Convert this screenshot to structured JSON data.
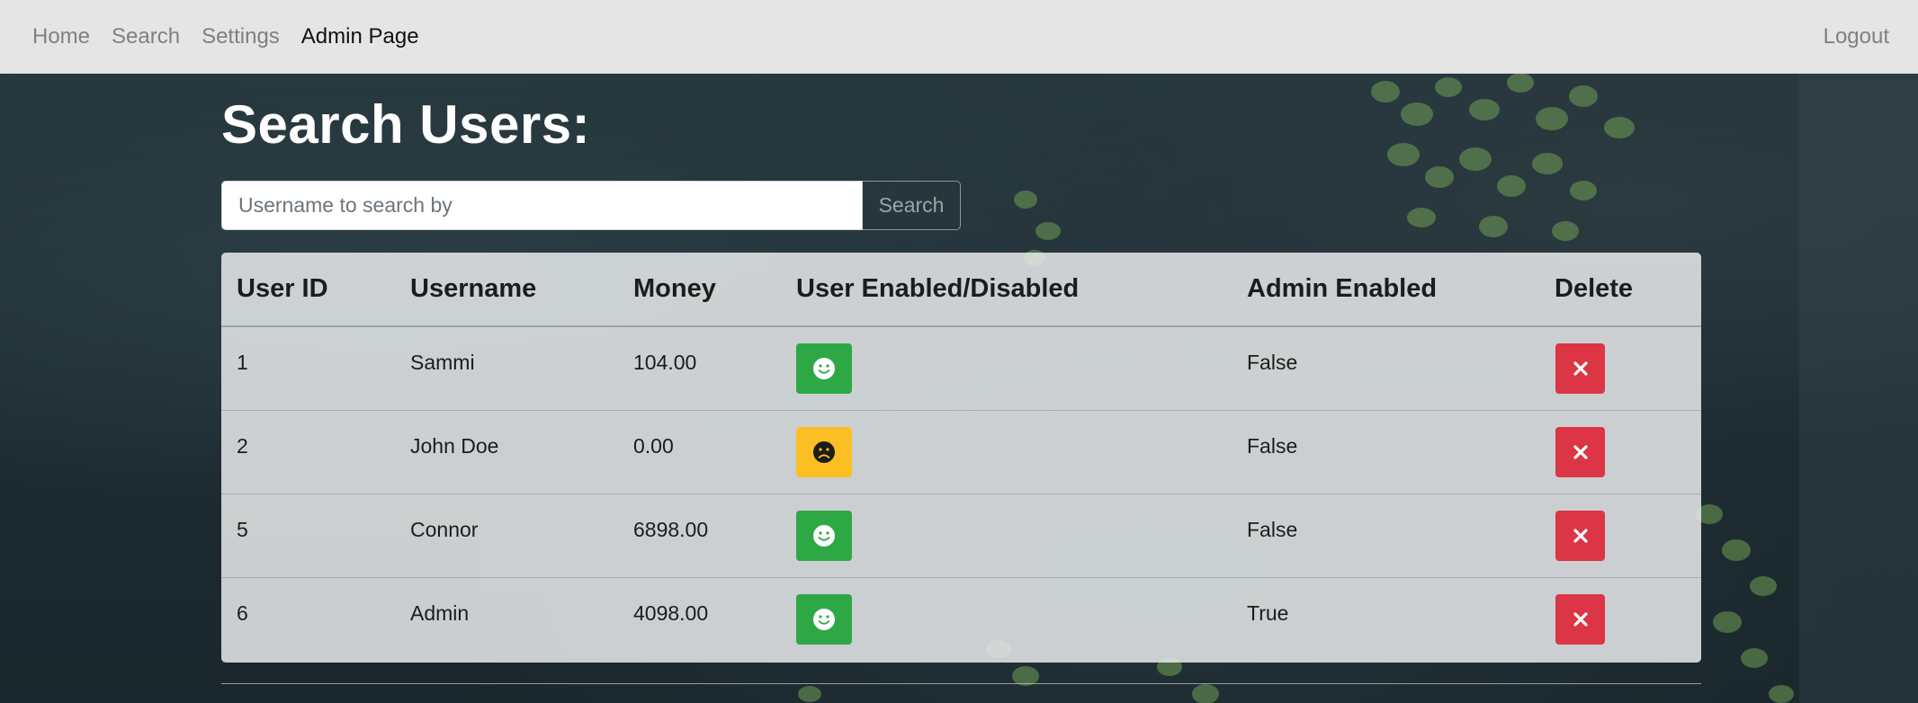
{
  "nav": {
    "links": [
      {
        "label": "Home"
      },
      {
        "label": "Search"
      },
      {
        "label": "Settings"
      },
      {
        "label": "Admin Page"
      }
    ],
    "logout_label": "Logout"
  },
  "page": {
    "title": "Search Users:"
  },
  "search": {
    "placeholder": "Username to search by",
    "value": "",
    "button_label": "Search"
  },
  "table": {
    "headers": [
      "User ID",
      "Username",
      "Money",
      "User Enabled/Disabled",
      "Admin Enabled",
      "Delete"
    ],
    "rows": [
      {
        "id": "1",
        "username": "Sammi",
        "money": "104.00",
        "user_enabled": true,
        "status_icon": "smile-icon",
        "admin_enabled": "False"
      },
      {
        "id": "2",
        "username": "John Doe",
        "money": "0.00",
        "user_enabled": false,
        "status_icon": "frown-icon",
        "admin_enabled": "False"
      },
      {
        "id": "5",
        "username": "Connor",
        "money": "6898.00",
        "user_enabled": true,
        "status_icon": "smile-icon",
        "admin_enabled": "False"
      },
      {
        "id": "6",
        "username": "Admin",
        "money": "4098.00",
        "user_enabled": true,
        "status_icon": "smile-icon",
        "admin_enabled": "True"
      }
    ]
  },
  "colors": {
    "enabled": "#2ea845",
    "disabled": "#fbbf24",
    "delete": "#dc3545"
  }
}
